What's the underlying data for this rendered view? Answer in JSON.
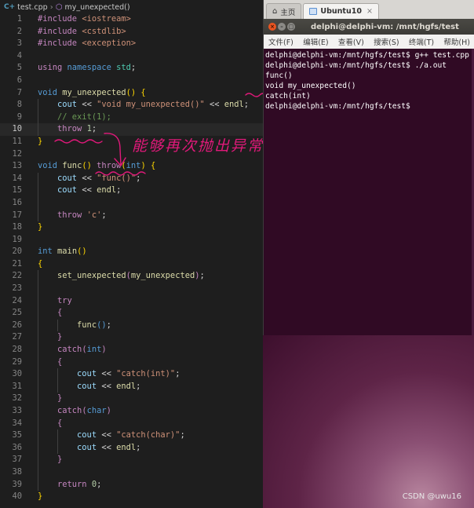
{
  "editor": {
    "breadcrumb": {
      "file_icon": "C+",
      "file": "test.cpp",
      "symbol": "my_unexpected()"
    },
    "lines": [
      {
        "n": "1",
        "html": "<span class=\"c\">#include</span> <span class=\"s\">&lt;iostream&gt;</span>"
      },
      {
        "n": "2",
        "html": "<span class=\"c\">#include</span> <span class=\"s\">&lt;cstdlib&gt;</span>"
      },
      {
        "n": "3",
        "html": "<span class=\"c\">#include</span> <span class=\"s\">&lt;exception&gt;</span>"
      },
      {
        "n": "4",
        "html": ""
      },
      {
        "n": "5",
        "html": "<span class=\"c\">using</span> <span class=\"k\">namespace</span> <span class=\"t\">std</span>;"
      },
      {
        "n": "6",
        "html": ""
      },
      {
        "n": "7",
        "html": "<span class=\"k\">void</span> <span class=\"f\">my_unexpected</span><span class=\"br\">()</span> <span class=\"br\">{</span>"
      },
      {
        "n": "8",
        "html": "    <span class=\"v\">cout</span> &lt;&lt; <span class=\"s\">\"void my_unexpected()\"</span> &lt;&lt; <span class=\"f\">endl</span>;"
      },
      {
        "n": "9",
        "html": "    <span class=\"cm\">// exit(1);</span>"
      },
      {
        "n": "10",
        "html": "    <span class=\"c\">throw</span> <span class=\"n\">1</span>;"
      },
      {
        "n": "11",
        "html": "<span class=\"br\">}</span>"
      },
      {
        "n": "12",
        "html": ""
      },
      {
        "n": "13",
        "html": "<span class=\"k\">void</span> <span class=\"f\">func</span><span class=\"br\">()</span> <span class=\"c\">throw</span><span class=\"br\">(</span><span class=\"k\">int</span><span class=\"br\">)</span> <span class=\"br\">{</span>"
      },
      {
        "n": "14",
        "html": "    <span class=\"v\">cout</span> &lt;&lt; <span class=\"s\">\"func()\"</span>;"
      },
      {
        "n": "15",
        "html": "    <span class=\"v\">cout</span> &lt;&lt; <span class=\"f\">endl</span>;"
      },
      {
        "n": "16",
        "html": ""
      },
      {
        "n": "17",
        "html": "    <span class=\"c\">throw</span> <span class=\"s\">'c'</span>;"
      },
      {
        "n": "18",
        "html": "<span class=\"br\">}</span>"
      },
      {
        "n": "19",
        "html": ""
      },
      {
        "n": "20",
        "html": "<span class=\"k\">int</span> <span class=\"f\">main</span><span class=\"br\">()</span>"
      },
      {
        "n": "21",
        "html": "<span class=\"br\">{</span>"
      },
      {
        "n": "22",
        "html": "    <span class=\"f\">set_unexpected</span><span class=\"c\">(</span><span class=\"f\">my_unexpected</span><span class=\"c\">)</span>;"
      },
      {
        "n": "23",
        "html": ""
      },
      {
        "n": "24",
        "html": "    <span class=\"c\">try</span>"
      },
      {
        "n": "25",
        "html": "    <span class=\"c\">{</span>"
      },
      {
        "n": "26",
        "html": "        <span class=\"f\">func</span><span class=\"k\">()</span>;"
      },
      {
        "n": "27",
        "html": "    <span class=\"c\">}</span>"
      },
      {
        "n": "28",
        "html": "    <span class=\"c\">catch</span><span class=\"c\">(</span><span class=\"k\">int</span><span class=\"c\">)</span>"
      },
      {
        "n": "29",
        "html": "    <span class=\"c\">{</span>"
      },
      {
        "n": "30",
        "html": "        <span class=\"v\">cout</span> &lt;&lt; <span class=\"s\">\"catch(int)\"</span>;"
      },
      {
        "n": "31",
        "html": "        <span class=\"v\">cout</span> &lt;&lt; <span class=\"f\">endl</span>;"
      },
      {
        "n": "32",
        "html": "    <span class=\"c\">}</span>"
      },
      {
        "n": "33",
        "html": "    <span class=\"c\">catch</span><span class=\"c\">(</span><span class=\"k\">char</span><span class=\"c\">)</span>"
      },
      {
        "n": "34",
        "html": "    <span class=\"c\">{</span>"
      },
      {
        "n": "35",
        "html": "        <span class=\"v\">cout</span> &lt;&lt; <span class=\"s\">\"catch(char)\"</span>;"
      },
      {
        "n": "36",
        "html": "        <span class=\"v\">cout</span> &lt;&lt; <span class=\"f\">endl</span>;"
      },
      {
        "n": "37",
        "html": "    <span class=\"c\">}</span>"
      },
      {
        "n": "38",
        "html": ""
      },
      {
        "n": "39",
        "html": "    <span class=\"c\">return</span> <span class=\"n\">0</span>;"
      },
      {
        "n": "40",
        "html": "<span class=\"br\">}</span>"
      }
    ],
    "annotation_text": "能够再次抛出异常",
    "annotation_color": "#e0197a"
  },
  "terminal": {
    "tabs": [
      {
        "label": "主页",
        "icon": "home-icon"
      },
      {
        "label": "Ubuntu10",
        "icon": "vm-icon",
        "close": "×"
      }
    ],
    "title": "delphi@delphi-vm: /mnt/hgfs/test",
    "window_buttons": {
      "close": "×",
      "min": "–",
      "max": "□"
    },
    "menu": [
      "文件(F)",
      "编辑(E)",
      "查看(V)",
      "搜索(S)",
      "终端(T)",
      "帮助(H)"
    ],
    "output": [
      "delphi@delphi-vm:/mnt/hgfs/test$ g++ test.cpp",
      "delphi@delphi-vm:/mnt/hgfs/test$ ./a.out",
      "func()",
      "void my_unexpected()",
      "catch(int)",
      "delphi@delphi-vm:/mnt/hgfs/test$"
    ]
  },
  "watermark": "CSDN @uwu16",
  "colors": {
    "terminal_bg": "#300a24",
    "editor_bg": "#1e1e1e",
    "ubuntu_orange": "#e95420"
  }
}
